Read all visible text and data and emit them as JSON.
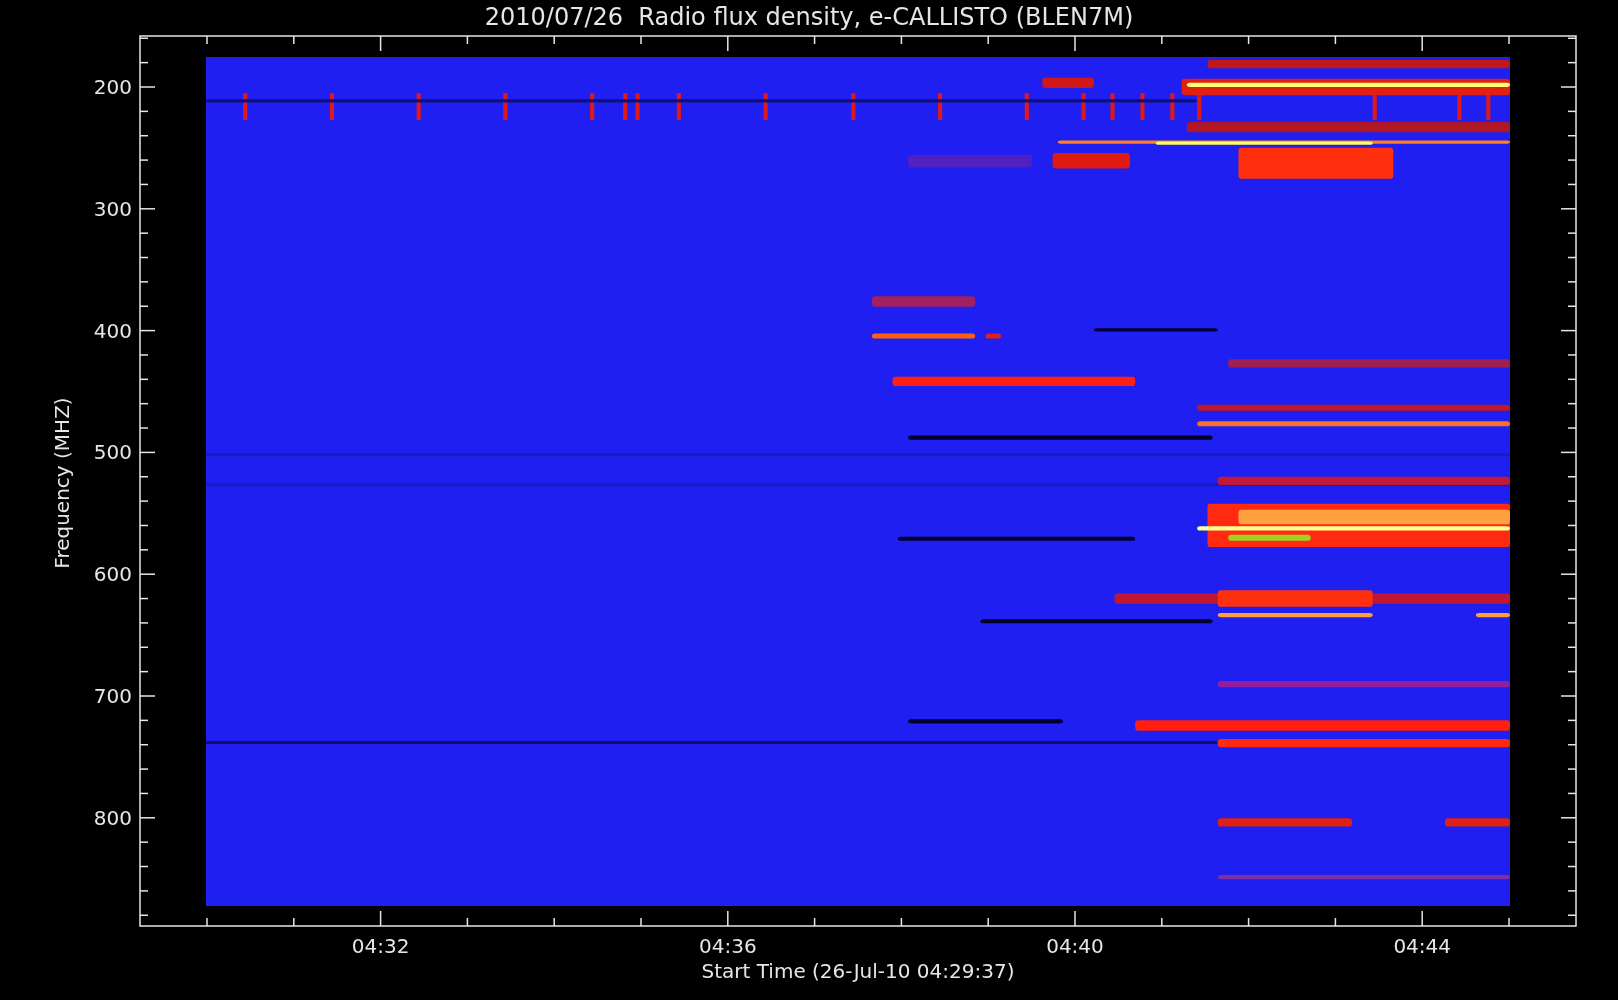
{
  "title": "2010/07/26  Radio flux density, e-CALLISTO (BLEN7M)",
  "y_axis": {
    "label": "Frequency (MHZ)",
    "tick_labels": [
      "200",
      "300",
      "400",
      "500",
      "600",
      "700",
      "800"
    ]
  },
  "x_axis": {
    "label": "Start Time (26-Jul-10 04:29:37)",
    "tick_labels": [
      "04:32",
      "04:36",
      "04:40",
      "04:44"
    ]
  }
}
